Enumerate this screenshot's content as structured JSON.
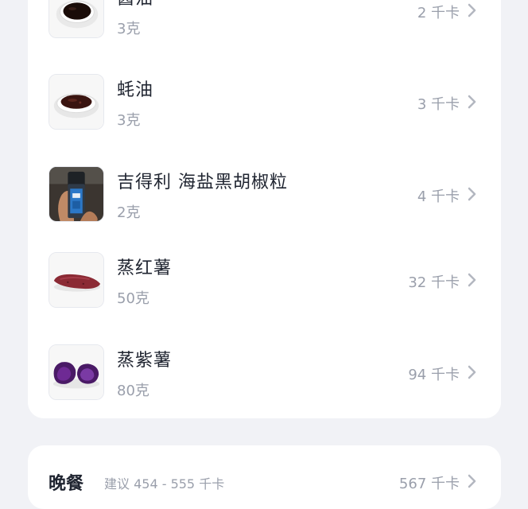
{
  "meal_items": [
    {
      "name": "酱油",
      "amount": "3克",
      "kcal": "2 千卡",
      "icon": "soy-sauce-dish-icon"
    },
    {
      "name": "蚝油",
      "amount": "3克",
      "kcal": "3 千卡",
      "icon": "oyster-sauce-dish-icon"
    },
    {
      "name": "吉得利 海盐黑胡椒粒",
      "amount": "2克",
      "kcal": "4 千卡",
      "icon": "pepper-grinder-icon"
    },
    {
      "name": "蒸红薯",
      "amount": "50克",
      "kcal": "32 千卡",
      "icon": "sweet-potato-icon"
    },
    {
      "name": "蒸紫薯",
      "amount": "80克",
      "kcal": "94 千卡",
      "icon": "purple-potato-icon"
    }
  ],
  "next_meal": {
    "title": "晚餐",
    "hint": "建议 454 - 555 千卡",
    "total": "567 千卡"
  },
  "colors": {
    "background": "#f1f2f6",
    "card": "#ffffff",
    "primary_text": "#1f2430",
    "secondary_text": "#9a9fab"
  }
}
